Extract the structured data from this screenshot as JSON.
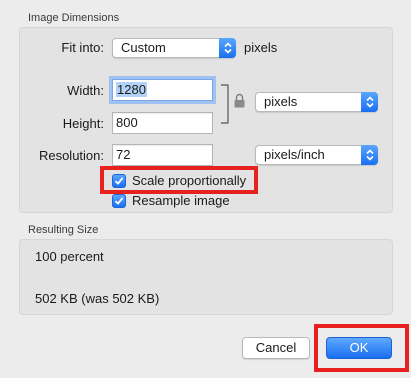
{
  "image_dimensions": {
    "section_title": "Image Dimensions",
    "fit_into": {
      "label": "Fit into:",
      "value": "Custom",
      "unit": "pixels"
    },
    "width": {
      "label": "Width:",
      "value": "1280"
    },
    "height": {
      "label": "Height:",
      "value": "800"
    },
    "size_unit": "pixels",
    "resolution": {
      "label": "Resolution:",
      "value": "72",
      "unit": "pixels/inch"
    },
    "scale_proportionally": {
      "label": "Scale proportionally",
      "checked": true
    },
    "resample_image": {
      "label": "Resample image",
      "checked": true
    }
  },
  "resulting_size": {
    "section_title": "Resulting Size",
    "percent": "100 percent",
    "file_size": "502 KB (was 502 KB)"
  },
  "buttons": {
    "cancel": "Cancel",
    "ok": "OK"
  },
  "colors": {
    "accent": "#1a6ff0",
    "highlight": "#e8201e",
    "background": "#ececec"
  },
  "icons": [
    "lock-icon",
    "chevron-updown-icon",
    "checkmark-icon"
  ]
}
